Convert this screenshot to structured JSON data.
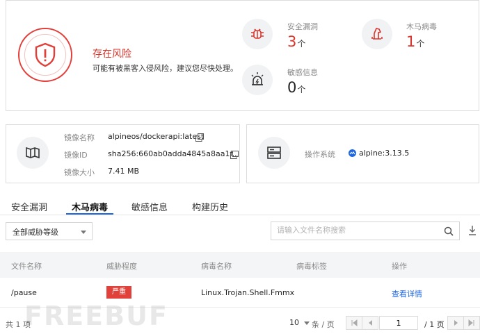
{
  "risk": {
    "title": "存在风险",
    "description": "可能有被黑客入侵风险，建议您尽快处理。",
    "stats": {
      "vuln": {
        "label": "安全漏洞",
        "value": "3",
        "unit": "个"
      },
      "trojan": {
        "label": "木马病毒",
        "value": "1",
        "unit": "个"
      },
      "sensitive": {
        "label": "敏感信息",
        "value": "0",
        "unit": "个"
      }
    }
  },
  "image": {
    "name_label": "镜像名称",
    "name_value": "alpineos/dockerapi:latest",
    "id_label": "镜像ID",
    "id_value": "sha256:660ab0adda4845a8aa1f...",
    "size_label": "镜像大小",
    "size_value": "7.41 MB"
  },
  "os": {
    "label": "操作系统",
    "value": "alpine:3.13.5"
  },
  "tabs": [
    "安全漏洞",
    "木马病毒",
    "敏感信息",
    "构建历史"
  ],
  "filter": {
    "level_selected": "全部威胁等级",
    "search_placeholder": "请输入文件名称搜索"
  },
  "table": {
    "headers": [
      "文件名称",
      "威胁程度",
      "病毒名称",
      "病毒标签",
      "操作"
    ],
    "rows": [
      {
        "file": "/pause",
        "level": "严重",
        "virus": "Linux.Trojan.Shell.Fmmx",
        "tag": "",
        "action": "查看详情"
      }
    ]
  },
  "pagination": {
    "total": "共 1 项",
    "page_size": "10",
    "per_page_unit": "条 / 页",
    "current_page": "1",
    "total_pages": "/ 1 页"
  },
  "watermark": "FREEBUF",
  "colors": {
    "danger": "#d9342b",
    "accent": "#1e67e0"
  }
}
